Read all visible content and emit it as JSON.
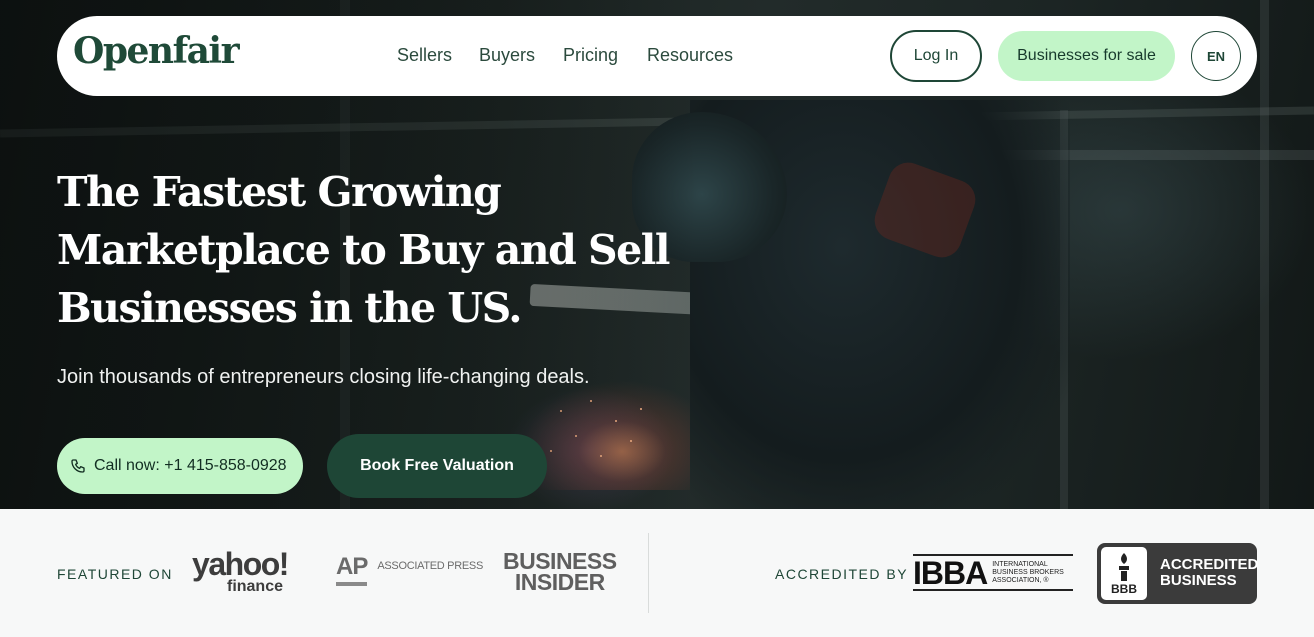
{
  "nav": {
    "logo": "Openfair",
    "links": [
      "Sellers",
      "Buyers",
      "Pricing",
      "Resources"
    ],
    "login_label": "Log In",
    "businesses_for_sale_label": "Businesses for sale",
    "language": "EN"
  },
  "hero": {
    "headline_lines": [
      "The Fastest Growing",
      "Marketplace to Buy and Sell",
      "Businesses in the US."
    ],
    "subheading": "Join thousands of entrepreneurs closing life-changing deals.",
    "call_label": "Call now: +1 415-858-0928",
    "book_label": "Book Free Valuation"
  },
  "featured": {
    "label": "FEATURED ON",
    "logos": {
      "yahoo_main": "yahoo!",
      "yahoo_sub": "finance",
      "ap_mark": "AP",
      "ap_text": "ASSOCIATED PRESS",
      "bi_line1": "BUSINESS",
      "bi_line2": "INSIDER"
    }
  },
  "accredited": {
    "label": "ACCREDITED BY",
    "ibba_mark": "IBBA",
    "ibba_text_lines": [
      "INTERNATIONAL",
      "BUSINESS BROKERS",
      "ASSOCIATION, ®"
    ],
    "bbb_seal": "BBB",
    "bbb_text_lines": [
      "ACCREDITED",
      "BUSINESS"
    ]
  },
  "colors": {
    "brand_dark_green": "#1e4636",
    "accent_mint": "#c2f5c8",
    "strip_background": "#f7f8f8"
  }
}
